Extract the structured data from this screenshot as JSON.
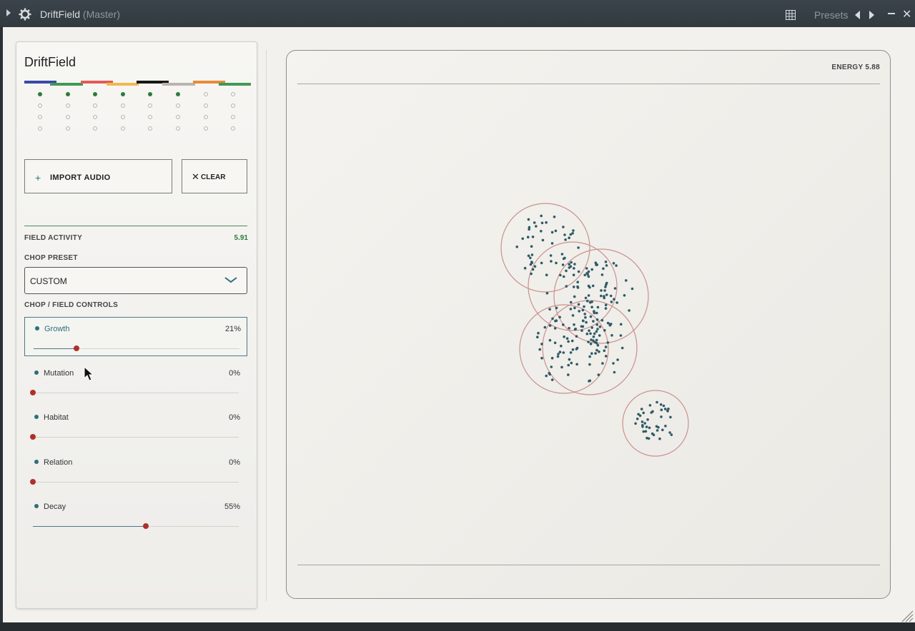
{
  "window": {
    "app_name": "DriftField",
    "context": "(Master)",
    "presets_label": "Presets"
  },
  "panel": {
    "title": "DriftField",
    "color_bar": [
      "#3a49a8",
      "#3f9a55",
      "#e25a55",
      "#f0b94e",
      "#161616",
      "#b9b5ad",
      "#e88a3a",
      "#3f9a55"
    ],
    "step_columns": 8,
    "step_rows": 4,
    "active_steps": [
      0,
      1,
      2,
      3,
      4,
      5
    ],
    "import_label": "IMPORT AUDIO",
    "clear_label": "CLEAR",
    "field_activity_label": "FIELD ACTIVITY",
    "field_activity_value": "5.91",
    "chop_preset_label": "CHOP PRESET",
    "chop_preset_value": "CUSTOM",
    "controls_label": "CHOP / FIELD CONTROLS",
    "controls": [
      {
        "name": "Growth",
        "value": 21,
        "display": "21%"
      },
      {
        "name": "Mutation",
        "value": 0,
        "display": "0%"
      },
      {
        "name": "Habitat",
        "value": 0,
        "display": "0%"
      },
      {
        "name": "Relation",
        "value": 0,
        "display": "0%"
      },
      {
        "name": "Decay",
        "value": 55,
        "display": "55%"
      }
    ]
  },
  "canvas": {
    "energy_label": "ENERGY 5.88",
    "dot_color": "#2e5a66",
    "ring_color": "#c9908e"
  }
}
